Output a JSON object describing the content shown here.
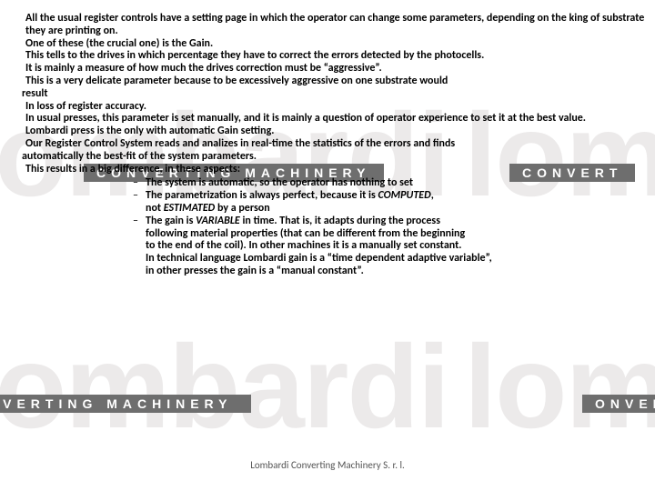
{
  "bg": {
    "word": "lombardi",
    "partial": "lom",
    "tag_full": "CONVERTING MACHINERY",
    "tag_right": "CONVERT",
    "tag_partial": "ONVERT"
  },
  "body": {
    "p1": " All the usual register controls have a setting page in which the operator can change some parameters, depending on the king of substrate they are printing on.",
    "p2": "One of these (the crucial one) is the Gain.",
    "p3": "This tells to the drives in which percentage they have to correct the errors detected by the photocells.",
    "p4": "It is mainly a measure of how much the drives correction must be “aggressive”.",
    "p5": "This is a very delicate parameter because to be excessively aggressive on one substrate would",
    "p6": "result",
    "p7": "In loss of register accuracy.",
    "p8": "In usual presses, this parameter is set manually, and it is mainly a question of operator experience to set it at the best value.",
    "p9": "Lombardi press is the only with automatic Gain setting.",
    "p10": "Our Register Control System reads and analizes in real-time the statistics of the errors and finds",
    "p11": "automatically the best-fit of the system parameters.",
    "p12": "This results in a big difference, in these aspects:",
    "b1": "The system is automatic, so the operator has nothing to set",
    "b2a": "The parametrization is always perfect, because it is ",
    "b2_em": "COMPUTED",
    "b2b": ",",
    "b2c_pre": "not ",
    "b2c_em": "ESTIMATED",
    "b2c_post": " by a person",
    "b3a_pre": "The gain is ",
    "b3a_em": "VARIABLE",
    "b3a_post": " in time. That is, it adapts during the process",
    "b3b": "following material properties (that can be different from the beginning",
    "b3c": "to the end of the coil). In other machines it is a manually set constant.",
    "b3d": "In technical language Lombardi gain is a “time dependent adaptive variable”,",
    "b3e": "in other presses the gain is a “manual constant”."
  },
  "footer": {
    "text": "Lombardi Converting Machinery S. r. l."
  }
}
